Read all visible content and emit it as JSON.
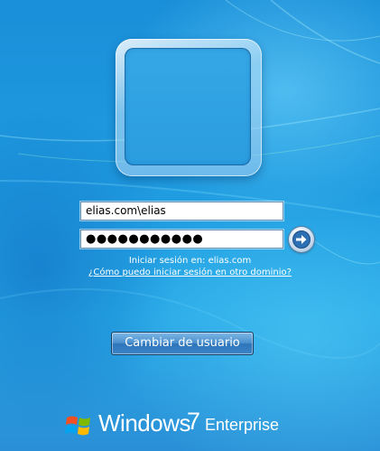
{
  "login": {
    "username": "elias.com\\elias",
    "password_masked": "●●●●●●●●●●●",
    "submit_icon": "arrow-right-icon",
    "domain_info": "Iniciar sesión en: elias.com",
    "other_domain_link": "¿Cómo puedo iniciar sesión en otro dominio?",
    "switch_user_label": "Cambiar de usuario",
    "user_tile_icon": "user-tile-icon"
  },
  "branding": {
    "logo_icon": "windows-flag-icon",
    "word": "Windows",
    "version": "7",
    "edition": "Enterprise"
  }
}
